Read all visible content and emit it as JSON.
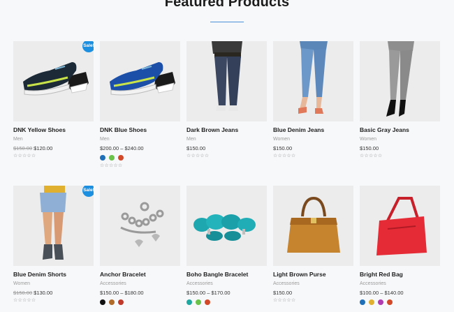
{
  "section": {
    "title": "Featured Products"
  },
  "products": [
    {
      "name": "DNK Yellow Shoes",
      "category": "Men",
      "old_price": "$150.00",
      "price": "$120.00",
      "sale": "Sale!",
      "stars": "☆☆☆☆☆",
      "swatches": []
    },
    {
      "name": "DNK Blue Shoes",
      "category": "Men",
      "old_price": "",
      "price": "$200.00 – $240.00",
      "sale": "",
      "stars": "☆☆☆☆☆",
      "swatches": [
        "#1f6fb8",
        "#6ac24a",
        "#d2492a"
      ]
    },
    {
      "name": "Dark Brown Jeans",
      "category": "Men",
      "old_price": "",
      "price": "$150.00",
      "sale": "",
      "stars": "☆☆☆☆☆",
      "swatches": []
    },
    {
      "name": "Blue Denim Jeans",
      "category": "Women",
      "old_price": "",
      "price": "$150.00",
      "sale": "",
      "stars": "☆☆☆☆☆",
      "swatches": []
    },
    {
      "name": "Basic Gray Jeans",
      "category": "Women",
      "old_price": "",
      "price": "$150.00",
      "sale": "",
      "stars": "☆☆☆☆☆",
      "swatches": []
    },
    {
      "name": "Blue Denim Shorts",
      "category": "Women",
      "old_price": "$150.00",
      "price": "$130.00",
      "sale": "Sale!",
      "stars": "☆☆☆☆☆",
      "swatches": []
    },
    {
      "name": "Anchor Bracelet",
      "category": "Accessories",
      "old_price": "",
      "price": "$150.00 – $180.00",
      "sale": "",
      "stars": "",
      "swatches": [
        "#111111",
        "#b06a2a",
        "#c0392b"
      ]
    },
    {
      "name": "Boho Bangle Bracelet",
      "category": "Accessories",
      "old_price": "",
      "price": "$150.00 – $170.00",
      "sale": "",
      "stars": "",
      "swatches": [
        "#1fa8a0",
        "#6ac24a",
        "#d2492a"
      ]
    },
    {
      "name": "Light Brown Purse",
      "category": "Accessories",
      "old_price": "",
      "price": "$150.00",
      "sale": "",
      "stars": "☆☆☆☆☆",
      "swatches": []
    },
    {
      "name": "Bright Red Bag",
      "category": "Accessories",
      "old_price": "",
      "price": "$100.00 – $140.00",
      "sale": "",
      "stars": "",
      "swatches": [
        "#1f6fb8",
        "#e0b030",
        "#b03ab0",
        "#d2492a"
      ]
    }
  ]
}
